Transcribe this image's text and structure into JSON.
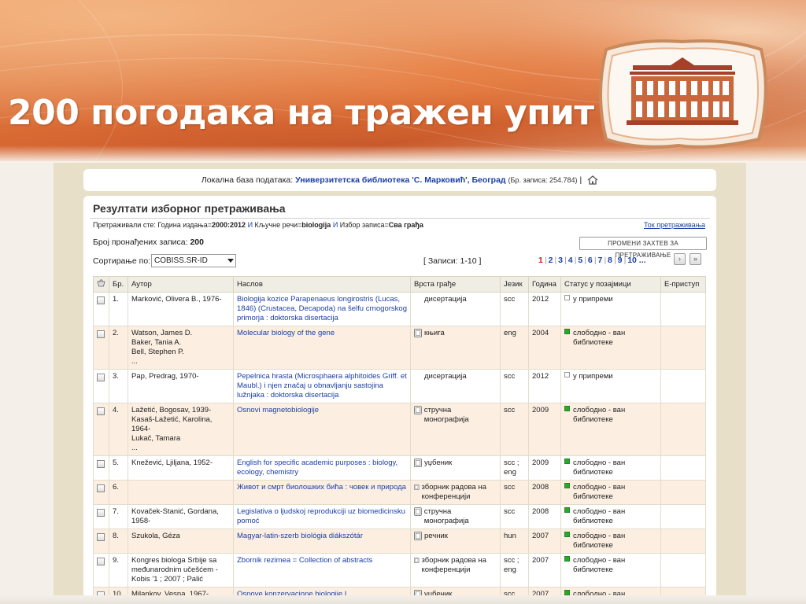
{
  "slide": {
    "title": "200 погодака на тражен упит"
  },
  "local_db": {
    "label": "Локална база података:",
    "library": "Универзитетска библиотека 'С. Марковић', Београд",
    "records": "(Бр. записа: 254.784)",
    "sep": "|"
  },
  "results": {
    "heading": "Резултати изборног претраживања",
    "query": {
      "prefix": "Претраживали сте:",
      "year_label": "Година издања=",
      "year_value": "2000:2012",
      "and1": "И",
      "kw_label": "Кључне речи=",
      "kw_value": "biologija",
      "and2": "И",
      "sel_label": "Избор записа=",
      "sel_value": "Сва грађа"
    },
    "flow_link": "Ток претраживања",
    "found_label": "Број пронађених записа:",
    "found_count": "200",
    "change_button": "ПРОМЕНИ ЗАХТЕВ ЗА ПРЕТРАЖИВАЊЕ",
    "sort_label": "Сортирање по:",
    "sort_value": "COBISS.SR-ID",
    "records_range": "[ Записи: 1-10 ]",
    "pages": [
      "1",
      "2",
      "3",
      "4",
      "5",
      "6",
      "7",
      "8",
      "9",
      "10 ..."
    ],
    "current_page": "1",
    "next_icon": "chevron-right-icon",
    "last_icon": "double-chevron-right-icon"
  },
  "table": {
    "headers": {
      "basket": "basket-icon",
      "num": "Бр.",
      "author": "Аутор",
      "title": "Наслов",
      "type": "Врста грађе",
      "lang": "Језик",
      "year": "Година",
      "status": "Статус у позајмици",
      "eaccess": "Е-приступ"
    },
    "rows": [
      {
        "num": "1.",
        "author": [
          "Marković, Olivera B., 1976-"
        ],
        "title": "Biologija kozice Parapenaeus longirostris (Lucas, 1846) (Crustacea, Decapoda) na šelfu crnogorskog primorja : doktorska disertacija",
        "type": "дисертација",
        "type_icon": false,
        "lang": "scc",
        "year": "2012",
        "status": "у припреми",
        "status_color": "white"
      },
      {
        "num": "2.",
        "author": [
          "Watson, James D.",
          "Baker, Tania A.",
          "Bell, Stephen P.",
          "..."
        ],
        "title": "Molecular biology of the gene",
        "type": "књига",
        "type_icon": true,
        "lang": "eng",
        "year": "2004",
        "status": "слободно - ван библиотеке",
        "status_color": "green"
      },
      {
        "num": "3.",
        "author": [
          "Pap, Predrag, 1970-"
        ],
        "title": "Pepelnica hrasta (Microsphaera alphitoides Griff. et Maubl.) i njen značaj u obnavljanju sastojina lužnjaka : doktorska disertacija",
        "type": "дисертација",
        "type_icon": false,
        "lang": "scc",
        "year": "2012",
        "status": "у припреми",
        "status_color": "white"
      },
      {
        "num": "4.",
        "author": [
          "Lažetić, Bogosav, 1939-",
          "Kasaš-Lažetić, Karolina, 1964-",
          "Lukač, Tamara",
          "..."
        ],
        "title": "Osnovi magnetobiologije",
        "type": "стручна монографија",
        "type_icon": true,
        "lang": "scc",
        "year": "2009",
        "status": "слободно - ван библиотеке",
        "status_color": "green"
      },
      {
        "num": "5.",
        "author": [
          "Knežević, Ljiljana, 1952-"
        ],
        "title": "English for specific academic purposes : biology, ecology, chemistry",
        "type": "уџбеник",
        "type_icon": true,
        "lang": "scc ; eng",
        "year": "2009",
        "status": "слободно - ван библиотеке",
        "status_color": "green"
      },
      {
        "num": "6.",
        "author": [
          ""
        ],
        "title": "Живот и смрт биолошких бића : човек и природа",
        "type": "зборник радова на конференцији",
        "type_icon": true,
        "lang": "scc",
        "year": "2008",
        "status": "слободно - ван библиотеке",
        "status_color": "green"
      },
      {
        "num": "7.",
        "author": [
          "Kovaček-Stanić, Gordana, 1958-"
        ],
        "title": "Legislativa o ljudskoj reprodukciji uz biomedicinsku pomoć",
        "type": "стручна монографија",
        "type_icon": true,
        "lang": "scc",
        "year": "2008",
        "status": "слободно - ван библиотеке",
        "status_color": "green"
      },
      {
        "num": "8.",
        "author": [
          "Szukola, Géza"
        ],
        "title": "Magyar-latin-szerb biológia diákszótár",
        "type": "речник",
        "type_icon": true,
        "lang": "hun",
        "year": "2007",
        "status": "слободно - ван библиотеке",
        "status_color": "green"
      },
      {
        "num": "9.",
        "author": [
          "Kongres biologa Srbije sa međunarodnim učešćem - Kobis '1 ; 2007 ; Palić"
        ],
        "title": "Zbornik rezimea = Collection of abstracts",
        "type": "зборник радова на конференцији",
        "type_icon": true,
        "lang": "scc ; eng",
        "year": "2007",
        "status": "слободно - ван библиотеке",
        "status_color": "green"
      },
      {
        "num": "10.",
        "author": [
          "Milankov, Vesna, 1967-"
        ],
        "title": "Osnove konzervacione biologije I",
        "type": "уџбеник",
        "type_icon": true,
        "lang": "scc",
        "year": "2007",
        "status": "слободно - ван библиотеке",
        "status_color": "green"
      }
    ]
  },
  "colors": {
    "link": "#1a3ea8",
    "current_page": "#d0141a",
    "status_available": "#2fa531",
    "row_alt": "#fcefe2"
  }
}
